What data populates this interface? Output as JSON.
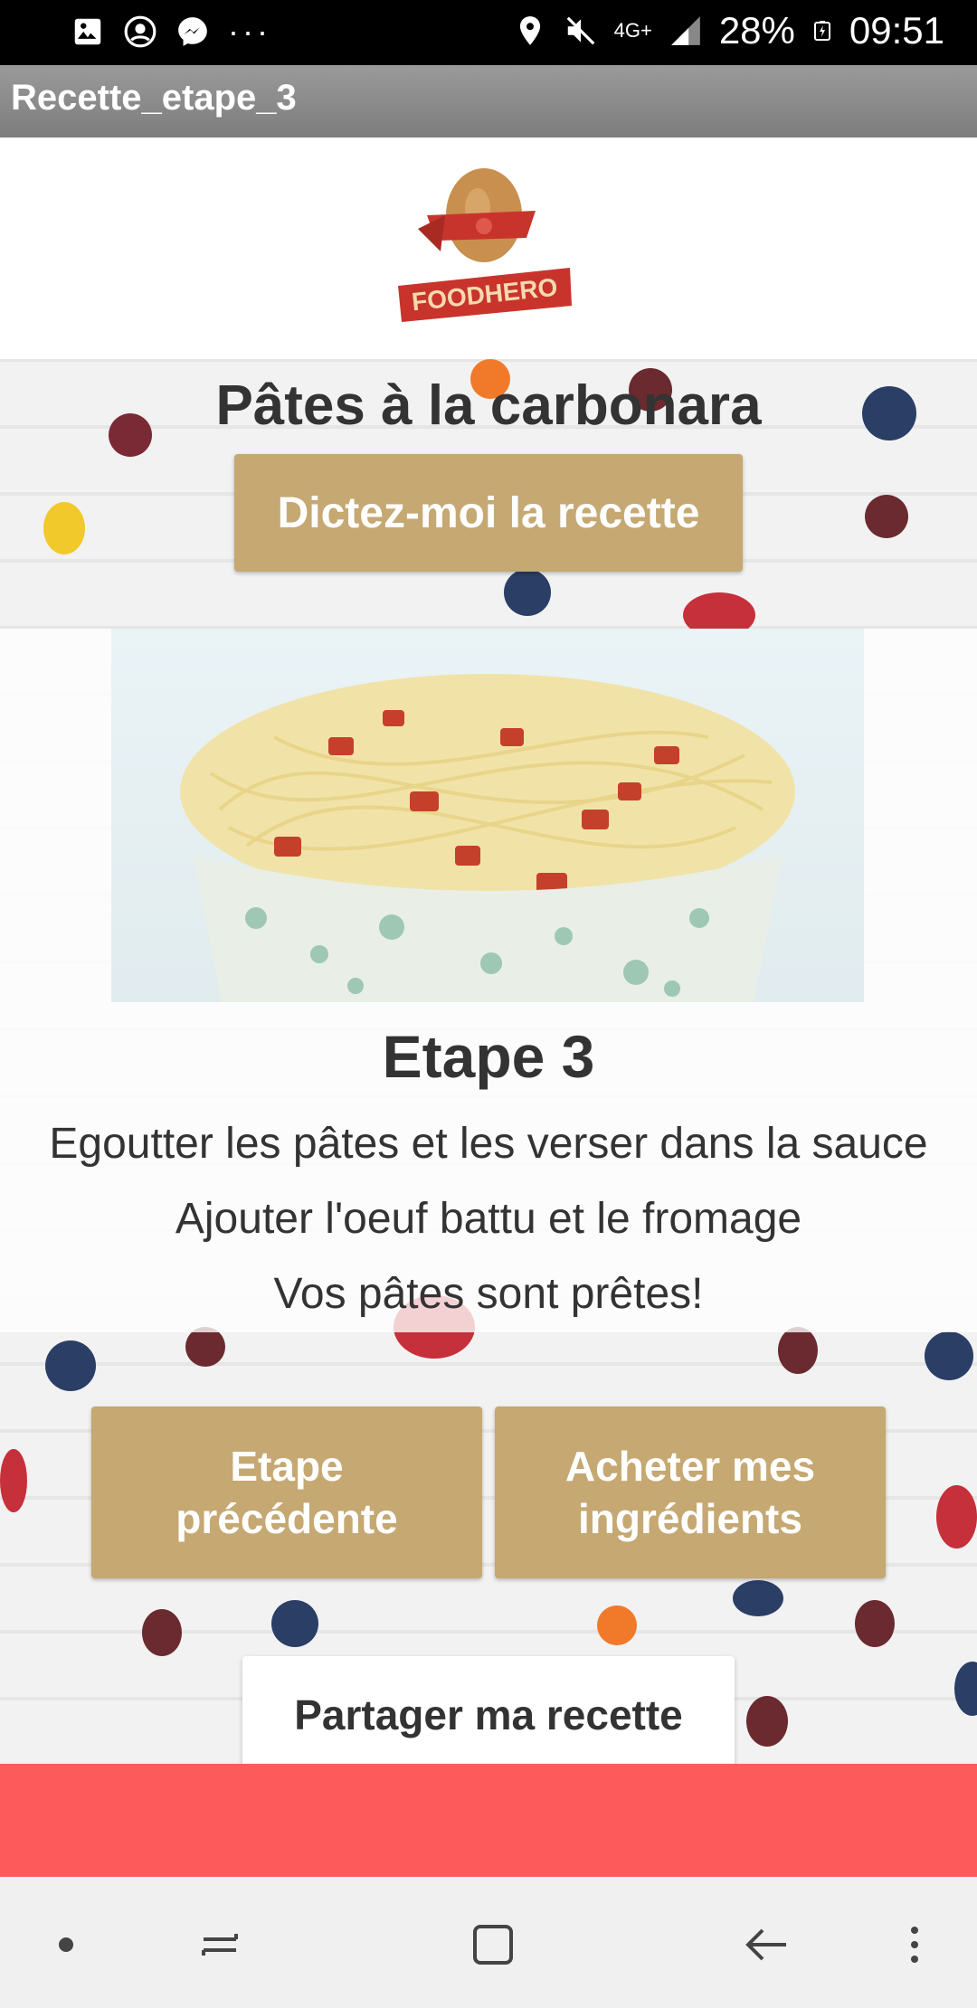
{
  "status_bar": {
    "left_icons": [
      "image-icon",
      "account-circle-icon",
      "messenger-icon",
      "more-dots-icon"
    ],
    "signal_label": "4G+",
    "battery": "28%",
    "time": "09:51"
  },
  "app_bar": {
    "title": "Recette_etape_3"
  },
  "logo": {
    "text": "FOODHERO",
    "colors": {
      "brand_red": "#c8342b",
      "egg": "#c98f4f"
    }
  },
  "recipe": {
    "title": "Pâtes à la carbonara",
    "dictate_button": "Dictez-moi la recette",
    "step_title": "Etape 3",
    "step_lines": [
      "Egoutter les pâtes et les verser dans la sauce",
      "Ajouter l'oeuf battu et le fromage",
      "Vos pâtes sont prêtes!"
    ]
  },
  "actions": {
    "prev_line1": "Etape",
    "prev_line2": "précédente",
    "buy_line1": "Acheter mes",
    "buy_line2": "ingrédients",
    "share": "Partager ma recette"
  },
  "colors": {
    "gold": "#c5a872",
    "red_bar": "#fd5b5b",
    "text": "#333333"
  },
  "nav_bar": {
    "items": [
      "dot-icon",
      "recent-apps-icon",
      "home-icon",
      "back-icon",
      "menu-dots-icon"
    ]
  }
}
